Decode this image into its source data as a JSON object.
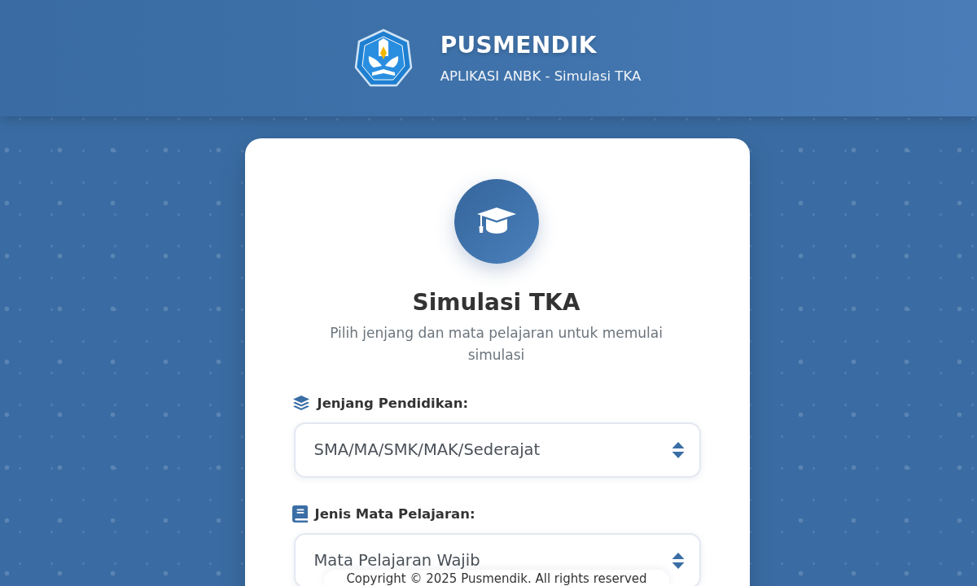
{
  "header": {
    "title": "PUSMENDIK",
    "subtitle": "APLIKASI ANBK - Simulasi TKA"
  },
  "card": {
    "title": "Simulasi TKA",
    "description": "Pilih jenjang dan mata pelajaran untuk memulai simulasi",
    "fields": [
      {
        "kind": "layers",
        "label": "Jenjang Pendidikan:",
        "value": "SMA/MA/SMK/MAK/Sederajat"
      },
      {
        "kind": "book",
        "label": "Jenis Mata Pelajaran:",
        "value": "Mata Pelajaran Wajib"
      }
    ]
  },
  "footer": {
    "text": "Copyright © 2025 Pusmendik. All rights reserved"
  }
}
